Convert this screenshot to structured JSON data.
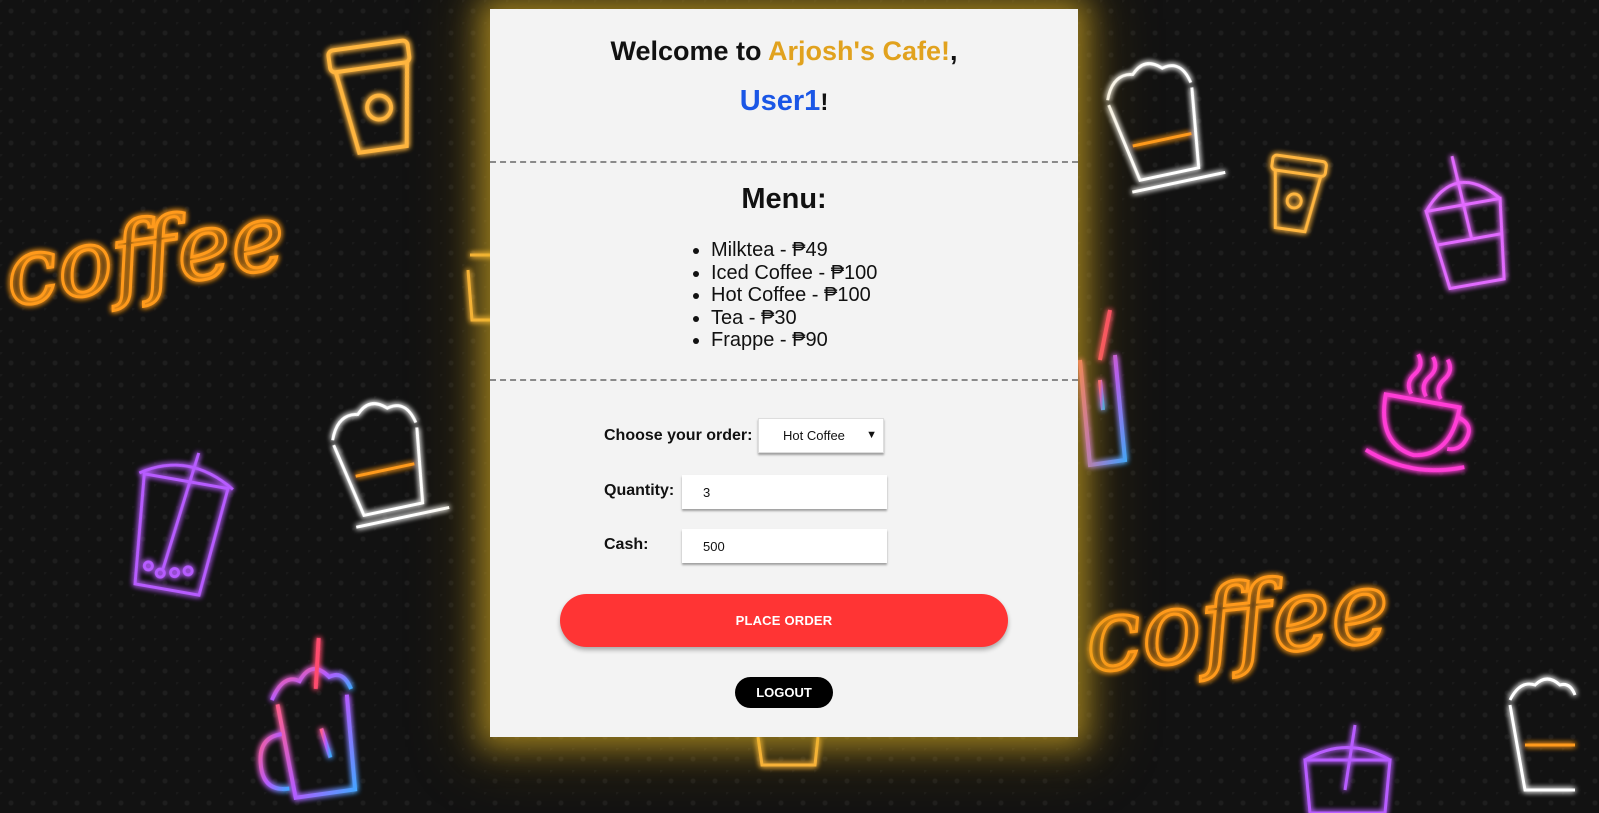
{
  "header": {
    "welcome_prefix": "Welcome to ",
    "cafe_name": "Arjosh's Cafe!",
    "comma": ",",
    "username": "User1",
    "exclaim": "!"
  },
  "menu": {
    "title": "Menu:",
    "items": [
      "Milktea - ₱49",
      "Iced Coffee - ₱100",
      "Hot Coffee - ₱100",
      "Tea - ₱30",
      "Frappe - ₱90"
    ]
  },
  "form": {
    "order_label": "Choose your order:",
    "order_selected": "Hot Coffee",
    "quantity_label": "Quantity:",
    "quantity_value": "3",
    "cash_label": "Cash:",
    "cash_value": "500"
  },
  "buttons": {
    "place_order": "PLACE ORDER",
    "logout": "LOGOUT"
  },
  "background": {
    "neon_sign_left": "coffee",
    "neon_sign_right": "coffee"
  },
  "colors": {
    "cafe_name": "#e1a21e",
    "username": "#1a56e6",
    "place_order_button": "#ff3434",
    "logout_button": "#000000"
  }
}
